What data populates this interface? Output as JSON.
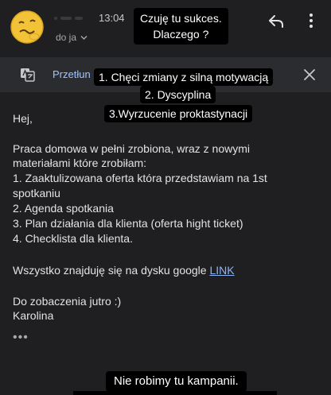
{
  "header": {
    "time": "13:04",
    "recipient": "do ja",
    "chevron": "chevron-down-icon"
  },
  "translate_bar": {
    "label": "Przetłun"
  },
  "overlays": {
    "top_line1": "Czuję tu sukces.",
    "top_line2": "Dlaczego ?",
    "list_1": "1. Chęci zmiany z silną motywacją",
    "list_2": "2. Dyscyplina",
    "list_3": "3.Wyrzucenie proktastynacji",
    "bottom": "Nie robimy tu kampanii."
  },
  "email": {
    "greeting": "Hej,",
    "para1_line1": "Praca domowa w pełni zrobiona, wraz z nowymi",
    "para1_line2": "materiałami które zrobiłam:",
    "item1_line1": "1. Zaaktulizowana oferta która przedstawiam na 1st",
    "item1_line2": "spotkaniu",
    "item2": "2. Agenda spotkania",
    "item3": "3. Plan działania dla klienta (oferta hight ticket)",
    "item4": "4. Checklista dla klienta.",
    "drive_text": "Wszystko znajduję się na dysku google ",
    "link_text": "LINK",
    "closing": "Do zobaczenia jutro :)",
    "signature": "Karolina",
    "ellipsis": "•••"
  },
  "colors": {
    "background": "#1f1f21",
    "translate_bar": "#2b2c30",
    "link": "#8ab4f8",
    "overlay": "#000000"
  }
}
